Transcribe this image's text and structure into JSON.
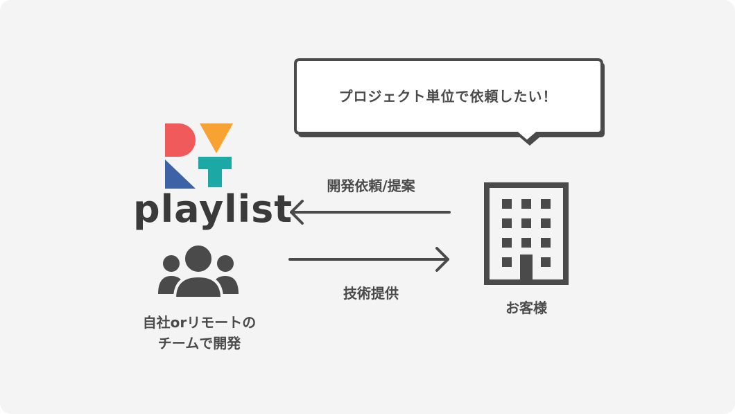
{
  "brand": {
    "name": "playlist"
  },
  "team": {
    "label_line1": "自社orリモートの",
    "label_line2": "チームで開発"
  },
  "client": {
    "label": "お客様"
  },
  "flow": {
    "request_label": "開発依頼/提案",
    "provide_label": "技術提供"
  },
  "speech_bubble": {
    "text": "プロジェクト単位で依頼したい！"
  },
  "colors": {
    "background": "#f4f4f4",
    "foreground": "#4a4a4a",
    "logo_red": "#f05a5b",
    "logo_orange": "#f7a233",
    "logo_blue": "#3d63a6",
    "logo_teal": "#1ca9a6"
  }
}
